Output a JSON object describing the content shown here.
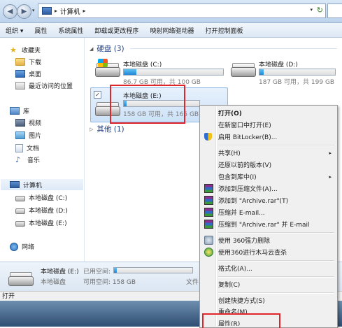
{
  "address": {
    "path": "计算机"
  },
  "toolbar": {
    "items": [
      "组织 ▾",
      "属性",
      "系统属性",
      "卸载或更改程序",
      "映射网络驱动器",
      "打开控制面板"
    ]
  },
  "nav": {
    "favorites": "收藏夹",
    "downloads": "下载",
    "desktop": "桌面",
    "recent": "最近访问的位置",
    "libraries": "库",
    "videos": "视频",
    "pictures": "图片",
    "documents": "文档",
    "music": "音乐",
    "computer": "计算机",
    "drive_c": "本地磁盘 (C:)",
    "drive_d": "本地磁盘 (D:)",
    "drive_e": "本地磁盘 (E:)",
    "network": "网络"
  },
  "content": {
    "hdd_header": "硬盘 (3)",
    "other_header": "其他 (1)",
    "drives": [
      {
        "name": "本地磁盘 (C:)",
        "info": "86.7 GB 可用，共 100 GB",
        "used_fraction": 0.13
      },
      {
        "name": "本地磁盘 (D:)",
        "info": "187 GB 可用，共 199 GB",
        "used_fraction": 0.06
      },
      {
        "name": "本地磁盘 (E:)",
        "info": "158 GB 可用，共 165 GB",
        "used_fraction": 0.04
      }
    ],
    "checkbox_mark": "✓"
  },
  "details": {
    "name": "本地磁盘 (E:)",
    "used_label": "已用空间:",
    "type": "本地磁盘",
    "free_label": "可用空间: 158 GB",
    "fs_label": "文件",
    "used_fraction": 0.04
  },
  "status": {
    "text": "打开"
  },
  "menu": {
    "items": [
      {
        "label": "打开(O)",
        "bold": true
      },
      {
        "label": "在新窗口中打开(E)"
      },
      {
        "label": "启用 BitLocker(B)...",
        "icon": "shield-icon"
      },
      {
        "label": "共享(H)",
        "submenu": true
      },
      {
        "label": "还原以前的版本(V)"
      },
      {
        "label": "包含到库中(I)",
        "submenu": true
      },
      {
        "label": "添加到压缩文件(A)...",
        "icon": "winrar-icon"
      },
      {
        "label": "添加到 \"Archive.rar\"(T)",
        "icon": "winrar-icon"
      },
      {
        "label": "压缩并 E-mail...",
        "icon": "winrar-icon"
      },
      {
        "label": "压缩到 \"Archive.rar\" 并 E-mail",
        "icon": "winrar-icon"
      },
      {
        "label": "使用 360强力删除",
        "icon": "360-delete-icon"
      },
      {
        "label": "使用360进行木马云查杀",
        "icon": "360-scan-icon"
      },
      {
        "label": "格式化(A)..."
      },
      {
        "label": "复制(C)"
      },
      {
        "label": "创建快捷方式(S)"
      },
      {
        "label": "重命名(M)"
      },
      {
        "label": "属性(R)"
      }
    ],
    "arrow": "▸"
  },
  "colors": {
    "highlight": "#e0262b",
    "header_blue": "#1e3e8a"
  }
}
